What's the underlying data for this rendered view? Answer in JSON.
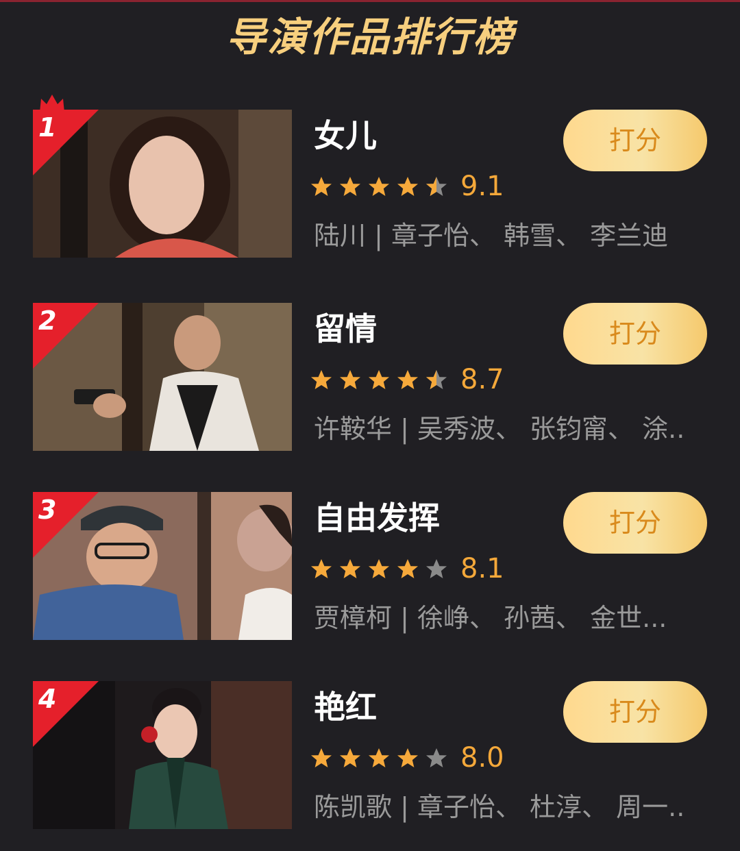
{
  "header": {
    "title": "导演作品排行榜"
  },
  "colors": {
    "background": "#201f23",
    "title_gold": "#f7cf7e",
    "rank_red": "#e5202b",
    "star_gold": "#f6a93b",
    "star_gray": "#8a8a8a",
    "score": "#f4a83a",
    "cast": "#9a9a9a"
  },
  "movies": [
    {
      "rank": "1",
      "title": "女儿",
      "rating": 9.1,
      "rating_text": "9.1",
      "stars_filled": 4.5,
      "cast": "陆川 | 章子怡、 韩雪、 李兰迪",
      "button_label": "打分",
      "crown_icon": "crown-icon"
    },
    {
      "rank": "2",
      "title": "留情",
      "rating": 8.7,
      "rating_text": "8.7",
      "stars_filled": 4.5,
      "cast": "许鞍华 | 吴秀波、 张钧甯、 涂..",
      "button_label": "打分"
    },
    {
      "rank": "3",
      "title": "自由发挥",
      "rating": 8.1,
      "rating_text": "8.1",
      "stars_filled": 4,
      "cast": "贾樟柯 | 徐峥、 孙茜、 金世...",
      "button_label": "打分"
    },
    {
      "rank": "4",
      "title": "艳红",
      "rating": 8.0,
      "rating_text": "8.0",
      "stars_filled": 4,
      "cast": "陈凯歌 | 章子怡、 杜淳、 周一..",
      "button_label": "打分"
    }
  ]
}
